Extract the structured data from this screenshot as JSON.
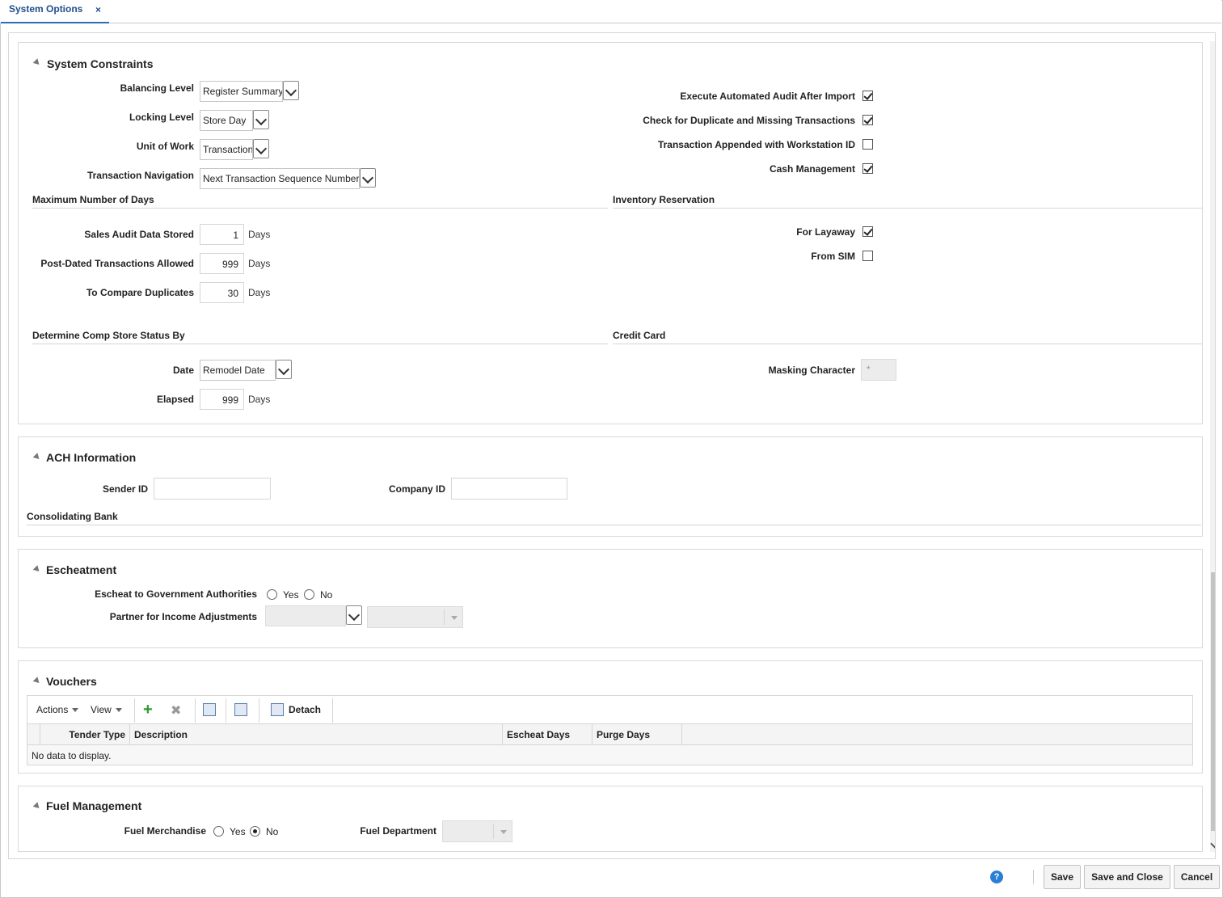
{
  "tab": {
    "title": "System Options",
    "close": "×"
  },
  "system_constraints": {
    "title": "System Constraints",
    "balancing_level": {
      "label": "Balancing Level",
      "value": "Register Summary"
    },
    "locking_level": {
      "label": "Locking Level",
      "value": "Store Day"
    },
    "unit_of_work": {
      "label": "Unit of Work",
      "value": "Transaction"
    },
    "transaction_navigation": {
      "label": "Transaction Navigation",
      "value": "Next Transaction Sequence Number"
    },
    "execute_audit": {
      "label": "Execute Automated Audit After Import",
      "checked": true
    },
    "check_duplicates": {
      "label": "Check for Duplicate and Missing Transactions",
      "checked": true
    },
    "workstation_id": {
      "label": "Transaction Appended with Workstation ID",
      "checked": false
    },
    "cash_management": {
      "label": "Cash Management",
      "checked": true
    },
    "max_days": {
      "title": "Maximum Number of Days",
      "sales_audit": {
        "label": "Sales Audit Data Stored",
        "value": "1"
      },
      "post_dated": {
        "label": "Post-Dated Transactions Allowed",
        "value": "999"
      },
      "compare_duplicates": {
        "label": "To Compare Duplicates",
        "value": "30"
      },
      "unit": "Days"
    },
    "inventory_reservation": {
      "title": "Inventory Reservation",
      "for_layaway": {
        "label": "For Layaway",
        "checked": true
      },
      "from_sim": {
        "label": "From SIM",
        "checked": false
      }
    },
    "comp_store": {
      "title": "Determine Comp Store Status By",
      "date": {
        "label": "Date",
        "value": "Remodel Date"
      },
      "elapsed": {
        "label": "Elapsed",
        "value": "999"
      },
      "unit": "Days"
    },
    "credit_card": {
      "title": "Credit Card",
      "masking": {
        "label": "Masking Character",
        "value": "*"
      }
    }
  },
  "ach": {
    "title": "ACH Information",
    "sender_id": {
      "label": "Sender ID",
      "value": ""
    },
    "company_id": {
      "label": "Company ID",
      "value": ""
    },
    "consolidating_bank": "Consolidating Bank"
  },
  "escheatment": {
    "title": "Escheatment",
    "escheat_gov": {
      "label": "Escheat to Government Authorities",
      "yes": "Yes",
      "no": "No",
      "selected": null
    },
    "partner": {
      "label": "Partner for Income Adjustments",
      "value": ""
    }
  },
  "vouchers": {
    "title": "Vouchers",
    "toolbar": {
      "actions": "Actions",
      "view": "View",
      "detach": "Detach"
    },
    "columns": [
      "Tender Type",
      "Description",
      "Escheat Days",
      "Purge Days"
    ],
    "empty_text": "No data to display."
  },
  "fuel": {
    "title": "Fuel Management",
    "merchandise": {
      "label": "Fuel Merchandise",
      "yes": "Yes",
      "no": "No",
      "selected": "No"
    },
    "department": {
      "label": "Fuel Department",
      "value": ""
    }
  },
  "footer": {
    "help": "?",
    "save": "Save",
    "save_close": "Save and Close",
    "cancel": "Cancel"
  }
}
